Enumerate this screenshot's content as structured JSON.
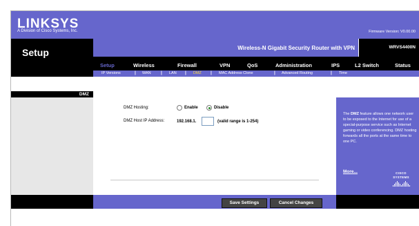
{
  "brand": {
    "logo_text": "LINKSYS",
    "logo_sub": "A Division of Cisco Systems, Inc.",
    "firmware": "Firmware Version: V0.00.00"
  },
  "header": {
    "section_title": "Setup",
    "product_name": "Wireless-N Gigabit Security Router with VPN",
    "model": "WRVS4400N"
  },
  "tabs": [
    {
      "label": "Setup",
      "active": true
    },
    {
      "label": "Wireless"
    },
    {
      "label": "Firewall"
    },
    {
      "label": "VPN"
    },
    {
      "label": "QoS"
    },
    {
      "label": "Administration"
    },
    {
      "label": "IPS"
    },
    {
      "label": "L2 Switch"
    },
    {
      "label": "Status"
    }
  ],
  "subtabs": [
    {
      "label": "IP Versions"
    },
    {
      "label": "WAN"
    },
    {
      "label": "LAN"
    },
    {
      "label": "DMZ",
      "active": true
    },
    {
      "label": "MAC Address Clone"
    },
    {
      "label": "Advanced Routing"
    },
    {
      "label": "Time"
    }
  ],
  "sidebar": {
    "label": "DMZ"
  },
  "form": {
    "dmz_hosting_label": "DMZ Hosting:",
    "enable_label": "Enable",
    "disable_label": "Disable",
    "selected": "Disable",
    "host_ip_label": "DMZ Host IP Address:",
    "ip_prefix": "192.168.1.",
    "ip_last_octet": "",
    "valid_range": "(valid range is 1-254)"
  },
  "help": {
    "text_bold": "DMZ",
    "text_before": "The ",
    "text_after": " feature allows one network user to be exposed to the Internet for use of a special-purpose service such as Internet gaming or video conferencing. DMZ hosting forwards all the ports at the same time to one PC.",
    "more": "More...",
    "cisco": "CISCO SYSTEMS"
  },
  "footer": {
    "save_label": "Save Settings",
    "cancel_label": "Cancel Changes"
  },
  "colors": {
    "accent": "#6666cc",
    "header_dark": "#000000",
    "active_subtab": "#ffdd33"
  }
}
